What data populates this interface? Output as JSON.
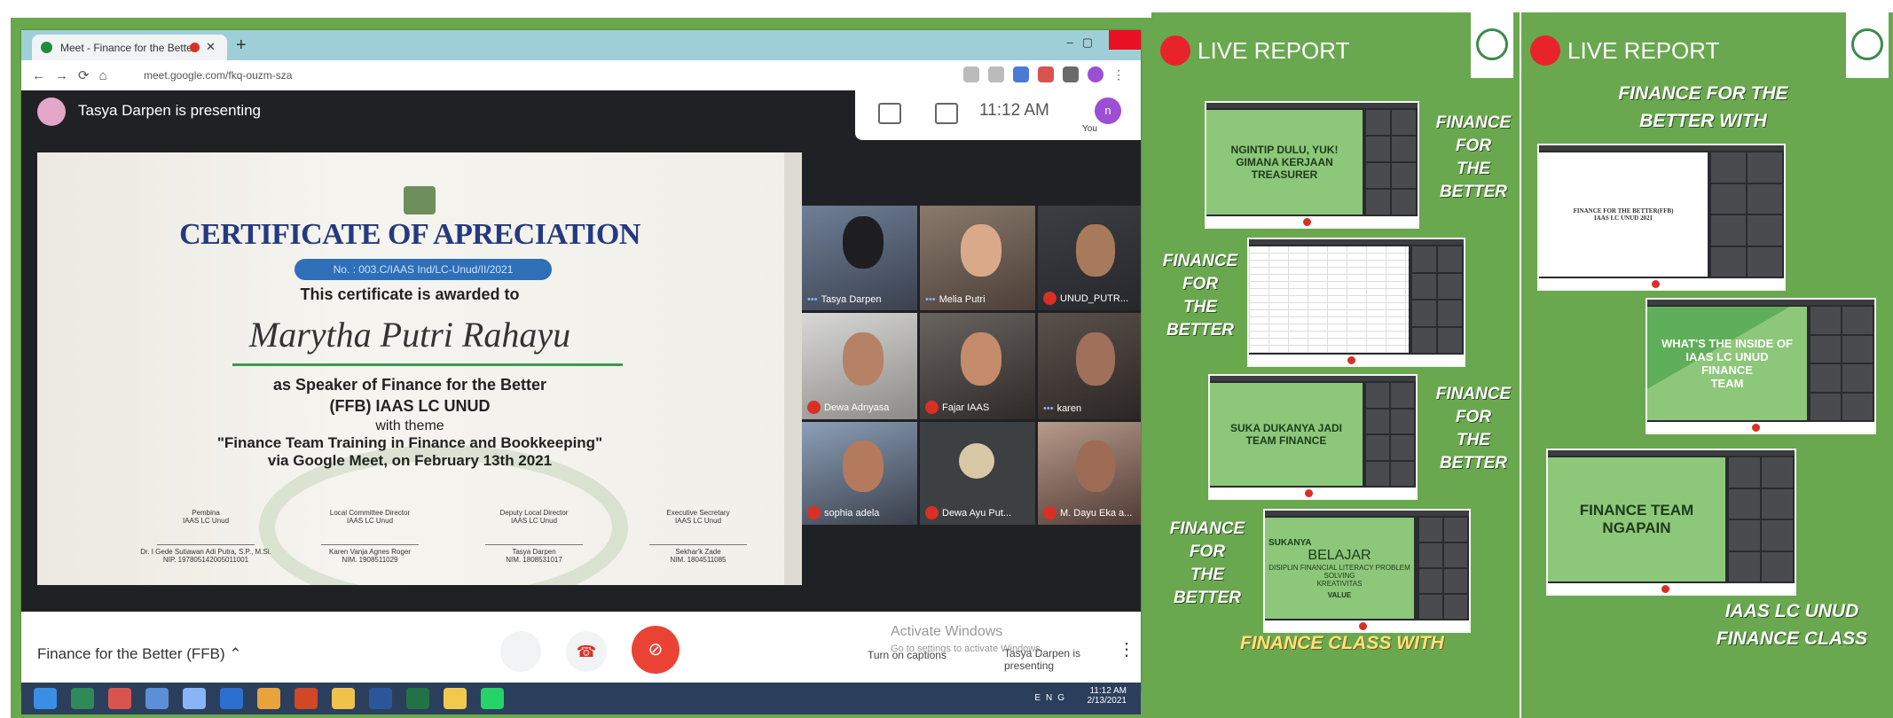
{
  "meet": {
    "tab_title": "Meet - Finance for the Bette",
    "url": "meet.google.com/fkq-ouzm-sza",
    "presenting_banner": "Tasya Darpen is presenting",
    "clock": "11:12 AM",
    "you_initial": "n",
    "you_label": "You",
    "meeting_name": "Finance for the Better (FFB)",
    "activate_windows": "Activate Windows",
    "activate_sub": "Go to settings to activate Windows.",
    "turn_on_captions": "Turn on captions",
    "presenter_status": "Tasya Darpen is presenting",
    "participants": [
      {
        "name": "Tasya Darpen",
        "muted": false
      },
      {
        "name": "Melia Putri",
        "muted": false
      },
      {
        "name": "UNUD_PUTR...",
        "muted": true
      },
      {
        "name": "Dewa Adnyasa",
        "muted": true
      },
      {
        "name": "Fajar IAAS",
        "muted": true
      },
      {
        "name": "karen",
        "muted": false
      },
      {
        "name": "sophia adela",
        "muted": true
      },
      {
        "name": "Dewa Ayu Put...",
        "muted": true
      },
      {
        "name": "M. Dayu Eka a...",
        "muted": true
      }
    ]
  },
  "certificate": {
    "title": "CERTIFICATE OF APRECIATION",
    "number": "No. : 003.C/IAAS Ind/LC-Unud/II/2021",
    "awarded": "This certificate is awarded to",
    "recipient": "Marytha Putri Rahayu",
    "as_line": "as Speaker of Finance for the Better",
    "ffb_line": "(FFB) IAAS LC UNUD",
    "theme_label": "with theme",
    "theme": "\"Finance Team Training in Finance and Bookkeeping\"",
    "via": "via Google Meet, on February 13th 2021",
    "signatures": [
      {
        "role": "Pembina",
        "org": "IAAS LC Unud",
        "name": "Dr. I Gede Sutiawan Adi Putra, S.P., M.Si.",
        "id": "NIP. 197805142005011001"
      },
      {
        "role": "Local Committee Director",
        "org": "IAAS LC Unud",
        "name": "Karen Vanja Agnes Roger",
        "id": "NIM. 1908511029"
      },
      {
        "role": "Deputy Local Director",
        "org": "IAAS LC Unud",
        "name": "Tasya Darpen",
        "id": "NIM. 1808531017"
      },
      {
        "role": "Executive Secretary",
        "org": "IAAS LC Unud",
        "name": "Sekhar'k Zade",
        "id": "NIM. 1804511085"
      }
    ]
  },
  "taskbar": {
    "time": "11:12 AM",
    "date": "2/13/2021",
    "lang": "ENG"
  },
  "panels": {
    "live_label": "LIVE REPORT",
    "mid": {
      "slide1": "NGINTIP DULU, YUK!\nGIMANA KERJAAN TREASURER",
      "slide3": "SUKA DUKANYA JADI\nTEAM FINANCE",
      "slide4_head": "SUKANYA",
      "slide4_title": "BELAJAR",
      "slide4_row": "DISIPLIN  FINANCIAL LITERACY  PROBLEM SOLVING",
      "slide4_k": "KREATIVITAS",
      "slide4_v": "VALUE",
      "label_a": "FINANCE\nFOR\nTHE\nBETTER",
      "label_b": "FINANCE\nFOR\nTHE\nBETTER",
      "label_c": "FINANCE\nFOR\nTHE\nBETTER",
      "label_d": "FINANCE\nFOR\nTHE\nBETTER",
      "bottom_caption": "FINANCE CLASS WITH"
    },
    "right": {
      "top_caption": "FINANCE FOR THE\nBETTER WITH",
      "doc_title": "FINANCE FOR THE BETTER(FFB)\nIAAS LC UNUD 2021",
      "slide2": "WHAT'S THE INSIDE OF\nIAAS LC UNUD\nFINANCE\nTEAM",
      "slide3": "FINANCE TEAM\nNGAPAIN",
      "bottom_caption": "IAAS LC UNUD\nFINANCE CLASS"
    }
  },
  "colors": {
    "panel_green": "#6aa84f",
    "cert_blue": "#243a80",
    "live_red": "#e8242a",
    "meet_red": "#ea4335"
  }
}
